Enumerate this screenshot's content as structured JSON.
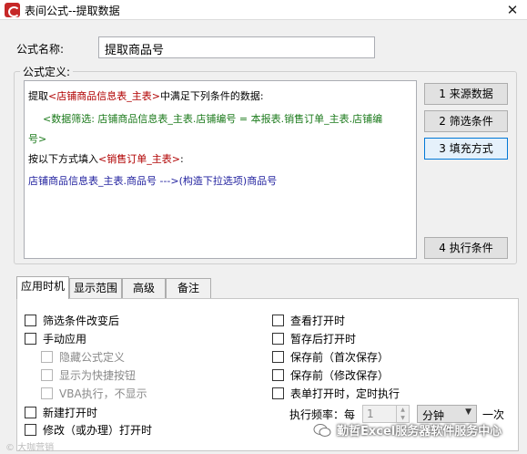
{
  "window": {
    "title": "表间公式--提取数据",
    "close_glyph": "✕"
  },
  "formula_name": {
    "label": "公式名称:",
    "value": "提取商品号"
  },
  "definition": {
    "group_label": "公式定义:",
    "line1_prefix": "提取",
    "line1_table": "<店铺商品信息表_主表>",
    "line1_suffix": "中满足下列条件的数据:",
    "line2": "<数据筛选: 店铺商品信息表_主表.店铺编号 = 本报表.销售订单_主表.店铺编",
    "line3": "号>",
    "line4_prefix": "按以下方式填入",
    "line4_table": "<销售订单_主表>",
    "line4_suffix": ":",
    "line5": "店铺商品信息表_主表.商品号  --->(构造下拉选项)商品号"
  },
  "side_buttons": {
    "source": "1  来源数据",
    "filter": "2  筛选条件",
    "fill": "3  填充方式",
    "exec": "4  执行条件"
  },
  "tabs": {
    "apply_time": "应用时机",
    "scope": "显示范围",
    "advanced": "高级",
    "notes": "备注"
  },
  "options": {
    "filter_changed": "筛选条件改变后",
    "manual_apply": "手动应用",
    "hide_formula": "隐藏公式定义",
    "show_shortcut": "显示为快捷按钮",
    "vba_hidden": "VBA执行，不显示",
    "new_open": "新建打开时",
    "modify_open": "修改（或办理）打开时",
    "view_open": "查看打开时",
    "draft_open": "暂存后打开时",
    "before_save_first": "保存前（首次保存）",
    "before_save_modify": "保存前（修改保存）",
    "form_open_timer": "表单打开时，定时执行"
  },
  "frequency": {
    "label": "执行频率：每",
    "value": "1",
    "unit": "分钟",
    "suffix": "一次"
  },
  "watermark": {
    "text": "勤哲Excel服务器软件服务中心",
    "corner": "©  大咖营销"
  }
}
